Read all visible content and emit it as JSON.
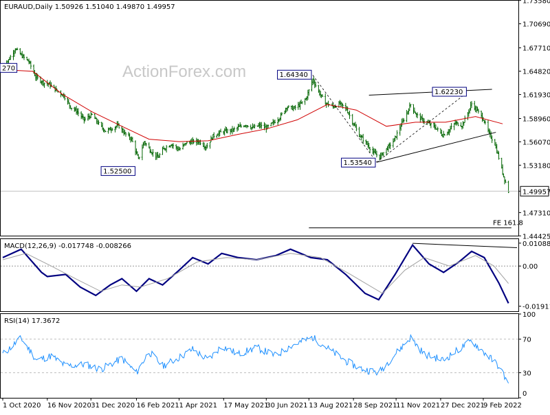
{
  "header": {
    "symbol_line": "EURAUD,Daily  1.50926 1.51040 1.49870 1.49957",
    "watermark": "ActionForex.com"
  },
  "colors": {
    "candle": "#006400",
    "ma": "#d00000",
    "macd": "#000080",
    "signal": "#a0a0a0",
    "rsi": "#1e90ff",
    "trendline": "#000000"
  },
  "chart_data": [
    {
      "type": "candlestick",
      "panel": "price",
      "title": "EURAUD,Daily",
      "ohlc_last": {
        "open": 1.50926,
        "high": 1.5104,
        "low": 1.4987,
        "close": 1.49957
      },
      "ylim": [
        1.4445,
        1.7355
      ],
      "y_ticks": [
        "1.73580",
        "1.70690",
        "1.67710",
        "1.64820",
        "1.61930",
        "1.58960",
        "1.56070",
        "1.53180",
        "1.49957",
        "1.47310",
        "1.44425"
      ],
      "x_ticks": [
        "1 Oct 2020",
        "16 Nov 2020",
        "31 Dec 2020",
        "16 Feb 2021",
        "1 Apr 2021",
        "17 May 2021",
        "30 Jun 2021",
        "13 Aug 2021",
        "28 Sep 2021",
        "11 Nov 2021",
        "27 Dec 2021",
        "9 Feb 2022"
      ],
      "current_price": "1.49957",
      "close_path": [
        [
          "2020-10-01",
          1.654
        ],
        [
          "2020-10-07",
          1.662
        ],
        [
          "2020-10-14",
          1.676
        ],
        [
          "2020-10-20",
          1.668
        ],
        [
          "2020-10-28",
          1.66
        ],
        [
          "2020-11-04",
          1.641
        ],
        [
          "2020-11-12",
          1.634
        ],
        [
          "2020-11-18",
          1.632
        ],
        [
          "2020-11-26",
          1.624
        ],
        [
          "2020-12-03",
          1.618
        ],
        [
          "2020-12-10",
          1.604
        ],
        [
          "2020-12-17",
          1.598
        ],
        [
          "2020-12-24",
          1.588
        ],
        [
          "2021-01-01",
          1.594
        ],
        [
          "2021-01-08",
          1.583
        ],
        [
          "2021-01-15",
          1.574
        ],
        [
          "2021-01-21",
          1.577
        ],
        [
          "2021-01-28",
          1.581
        ],
        [
          "2021-02-04",
          1.571
        ],
        [
          "2021-02-11",
          1.564
        ],
        [
          "2021-02-18",
          1.539
        ],
        [
          "2021-02-24",
          1.561
        ],
        [
          "2021-03-03",
          1.549
        ],
        [
          "2021-03-10",
          1.541
        ],
        [
          "2021-03-16",
          1.552
        ],
        [
          "2021-03-24",
          1.558
        ],
        [
          "2021-04-01",
          1.551
        ],
        [
          "2021-04-08",
          1.559
        ],
        [
          "2021-04-15",
          1.561
        ],
        [
          "2021-04-22",
          1.561
        ],
        [
          "2021-04-29",
          1.554
        ],
        [
          "2021-05-06",
          1.568
        ],
        [
          "2021-05-13",
          1.572
        ],
        [
          "2021-05-19",
          1.574
        ],
        [
          "2021-05-26",
          1.575
        ],
        [
          "2021-06-02",
          1.579
        ],
        [
          "2021-06-09",
          1.582
        ],
        [
          "2021-06-16",
          1.578
        ],
        [
          "2021-06-23",
          1.581
        ],
        [
          "2021-06-30",
          1.578
        ],
        [
          "2021-07-07",
          1.584
        ],
        [
          "2021-07-14",
          1.591
        ],
        [
          "2021-07-21",
          1.604
        ],
        [
          "2021-07-28",
          1.602
        ],
        [
          "2021-08-04",
          1.607
        ],
        [
          "2021-08-10",
          1.614
        ],
        [
          "2021-08-17",
          1.638
        ],
        [
          "2021-08-23",
          1.623
        ],
        [
          "2021-08-30",
          1.609
        ],
        [
          "2021-09-07",
          1.604
        ],
        [
          "2021-09-14",
          1.608
        ],
        [
          "2021-09-21",
          1.601
        ],
        [
          "2021-09-28",
          1.583
        ],
        [
          "2021-10-04",
          1.569
        ],
        [
          "2021-10-12",
          1.558
        ],
        [
          "2021-10-18",
          1.548
        ],
        [
          "2021-10-25",
          1.542
        ],
        [
          "2021-11-02",
          1.553
        ],
        [
          "2021-11-08",
          1.561
        ],
        [
          "2021-11-11",
          1.568
        ],
        [
          "2021-11-16",
          1.581
        ],
        [
          "2021-11-22",
          1.596
        ],
        [
          "2021-11-26",
          1.607
        ],
        [
          "2021-12-02",
          1.594
        ],
        [
          "2021-12-08",
          1.588
        ],
        [
          "2021-12-15",
          1.583
        ],
        [
          "2021-12-22",
          1.578
        ],
        [
          "2021-12-29",
          1.569
        ],
        [
          "2022-01-04",
          1.574
        ],
        [
          "2022-01-11",
          1.584
        ],
        [
          "2022-01-18",
          1.581
        ],
        [
          "2022-01-24",
          1.596
        ],
        [
          "2022-01-28",
          1.608
        ],
        [
          "2022-02-03",
          1.599
        ],
        [
          "2022-02-09",
          1.589
        ],
        [
          "2022-02-15",
          1.571
        ],
        [
          "2022-02-21",
          1.558
        ],
        [
          "2022-02-25",
          1.541
        ],
        [
          "2022-03-02",
          1.518
        ],
        [
          "2022-03-07",
          1.49957
        ]
      ],
      "moving_average": [
        [
          "2020-10-01",
          1.65
        ],
        [
          "2020-11-01",
          1.648
        ],
        [
          "2020-12-01",
          1.62
        ],
        [
          "2021-01-01",
          1.598
        ],
        [
          "2021-02-01",
          1.58
        ],
        [
          "2021-03-01",
          1.564
        ],
        [
          "2021-04-01",
          1.561
        ],
        [
          "2021-05-01",
          1.562
        ],
        [
          "2021-06-01",
          1.57
        ],
        [
          "2021-07-01",
          1.577
        ],
        [
          "2021-08-01",
          1.588
        ],
        [
          "2021-09-01",
          1.607
        ],
        [
          "2021-10-01",
          1.6
        ],
        [
          "2021-11-01",
          1.58
        ],
        [
          "2021-12-01",
          1.585
        ],
        [
          "2022-01-01",
          1.585
        ],
        [
          "2022-02-01",
          1.592
        ],
        [
          "2022-03-01",
          1.583
        ]
      ],
      "annotations": [
        {
          "text": "270",
          "date": "2020-10-07",
          "price": 1.6527
        },
        {
          "text": "1.52500",
          "date": "2021-02-16",
          "price": 1.525
        },
        {
          "text": "1.64340",
          "date": "2021-08-17",
          "price": 1.6434
        },
        {
          "text": "1.53540",
          "date": "2021-10-22",
          "price": 1.5354
        },
        {
          "text": "1.62230",
          "date": "2022-01-24",
          "price": 1.6223
        },
        {
          "text": "FE 161.8",
          "date": "2022-02-18",
          "price": 1.4542
        }
      ],
      "trendlines": [
        {
          "from": [
            "2021-10-14",
            1.6185
          ],
          "to": [
            "2022-02-18",
            1.6257
          ]
        },
        {
          "from": [
            "2021-10-22",
            1.5354
          ],
          "to": [
            "2022-02-22",
            1.5725
          ]
        },
        {
          "from": [
            "2021-08-13",
            1.4542
          ],
          "to": [
            "2022-03-10",
            1.4542
          ]
        }
      ],
      "dashed_lines": [
        {
          "from": [
            "2021-08-17",
            1.6434
          ],
          "to": [
            "2021-10-22",
            1.5354
          ]
        },
        {
          "from": [
            "2021-10-22",
            1.5354
          ],
          "to": [
            "2022-01-24",
            1.6223
          ]
        }
      ]
    },
    {
      "type": "line",
      "panel": "macd",
      "title": "MACD(12,26,9) -0.017748 -0.008266",
      "ylim": [
        -0.0215,
        0.0128
      ],
      "y_ticks": [
        "0.010882",
        "0.00",
        "-0.019112"
      ],
      "series": [
        {
          "name": "MACD",
          "points": [
            [
              "2020-10-01",
              0.004
            ],
            [
              "2020-10-20",
              0.008
            ],
            [
              "2020-11-10",
              -0.003
            ],
            [
              "2020-11-16",
              -0.005
            ],
            [
              "2020-12-05",
              -0.004
            ],
            [
              "2020-12-20",
              -0.01
            ],
            [
              "2021-01-05",
              -0.014
            ],
            [
              "2021-01-20",
              -0.009
            ],
            [
              "2021-02-01",
              -0.006
            ],
            [
              "2021-02-16",
              -0.012
            ],
            [
              "2021-03-01",
              -0.006
            ],
            [
              "2021-03-15",
              -0.009
            ],
            [
              "2021-04-01",
              -0.002
            ],
            [
              "2021-04-15",
              0.004
            ],
            [
              "2021-05-01",
              0.001
            ],
            [
              "2021-05-15",
              0.006
            ],
            [
              "2021-06-01",
              0.004
            ],
            [
              "2021-06-20",
              0.003
            ],
            [
              "2021-07-10",
              0.005
            ],
            [
              "2021-07-25",
              0.008
            ],
            [
              "2021-08-15",
              0.004
            ],
            [
              "2021-09-01",
              0.003
            ],
            [
              "2021-09-20",
              -0.004
            ],
            [
              "2021-10-10",
              -0.013
            ],
            [
              "2021-10-24",
              -0.016
            ],
            [
              "2021-11-10",
              -0.004
            ],
            [
              "2021-11-28",
              0.01
            ],
            [
              "2021-12-15",
              0.001
            ],
            [
              "2021-12-30",
              -0.003
            ],
            [
              "2022-01-15",
              0.002
            ],
            [
              "2022-01-28",
              0.007
            ],
            [
              "2022-02-10",
              0.004
            ],
            [
              "2022-02-25",
              -0.008
            ],
            [
              "2022-03-07",
              -0.0177
            ]
          ]
        },
        {
          "name": "Signal",
          "points": [
            [
              "2020-10-01",
              0.003
            ],
            [
              "2020-10-25",
              0.006
            ],
            [
              "2020-11-20",
              0.0
            ],
            [
              "2020-12-15",
              -0.006
            ],
            [
              "2021-01-10",
              -0.012
            ],
            [
              "2021-02-01",
              -0.009
            ],
            [
              "2021-02-20",
              -0.01
            ],
            [
              "2021-03-20",
              -0.006
            ],
            [
              "2021-04-20",
              0.002
            ],
            [
              "2021-05-20",
              0.004
            ],
            [
              "2021-06-20",
              0.003
            ],
            [
              "2021-07-25",
              0.006
            ],
            [
              "2021-08-25",
              0.004
            ],
            [
              "2021-09-25",
              -0.004
            ],
            [
              "2021-10-28",
              -0.013
            ],
            [
              "2021-11-20",
              -0.002
            ],
            [
              "2021-12-10",
              0.004
            ],
            [
              "2022-01-05",
              0.0
            ],
            [
              "2022-02-01",
              0.005
            ],
            [
              "2022-02-20",
              0.0
            ],
            [
              "2022-03-07",
              -0.0083
            ]
          ]
        }
      ],
      "trendline": {
        "from": [
          "2021-11-28",
          0.0108
        ],
        "to": [
          "2022-03-07",
          0.0087
        ]
      }
    },
    {
      "type": "line",
      "panel": "rsi",
      "title": "RSI(14) 17.3672",
      "ylim": [
        0,
        100
      ],
      "y_ticks": [
        "100",
        "70",
        "30",
        "0"
      ],
      "levels": [
        70,
        30
      ],
      "series": [
        {
          "name": "RSI",
          "points": [
            [
              "2020-10-01",
              52
            ],
            [
              "2020-10-20",
              71
            ],
            [
              "2020-11-05",
              45
            ],
            [
              "2020-11-20",
              50
            ],
            [
              "2020-12-05",
              38
            ],
            [
              "2020-12-25",
              40
            ],
            [
              "2021-01-10",
              34
            ],
            [
              "2021-02-01",
              47
            ],
            [
              "2021-02-16",
              30
            ],
            [
              "2021-03-01",
              55
            ],
            [
              "2021-03-15",
              38
            ],
            [
              "2021-04-01",
              48
            ],
            [
              "2021-04-15",
              58
            ],
            [
              "2021-05-01",
              45
            ],
            [
              "2021-05-15",
              62
            ],
            [
              "2021-06-01",
              52
            ],
            [
              "2021-06-20",
              60
            ],
            [
              "2021-07-10",
              50
            ],
            [
              "2021-07-25",
              62
            ],
            [
              "2021-08-17",
              72
            ],
            [
              "2021-09-05",
              56
            ],
            [
              "2021-09-20",
              44
            ],
            [
              "2021-10-05",
              35
            ],
            [
              "2021-10-24",
              30
            ],
            [
              "2021-11-10",
              52
            ],
            [
              "2021-11-26",
              72
            ],
            [
              "2021-12-10",
              52
            ],
            [
              "2021-12-30",
              45
            ],
            [
              "2022-01-15",
              58
            ],
            [
              "2022-01-28",
              68
            ],
            [
              "2022-02-10",
              54
            ],
            [
              "2022-02-25",
              38
            ],
            [
              "2022-03-07",
              17.4
            ]
          ]
        }
      ]
    }
  ]
}
